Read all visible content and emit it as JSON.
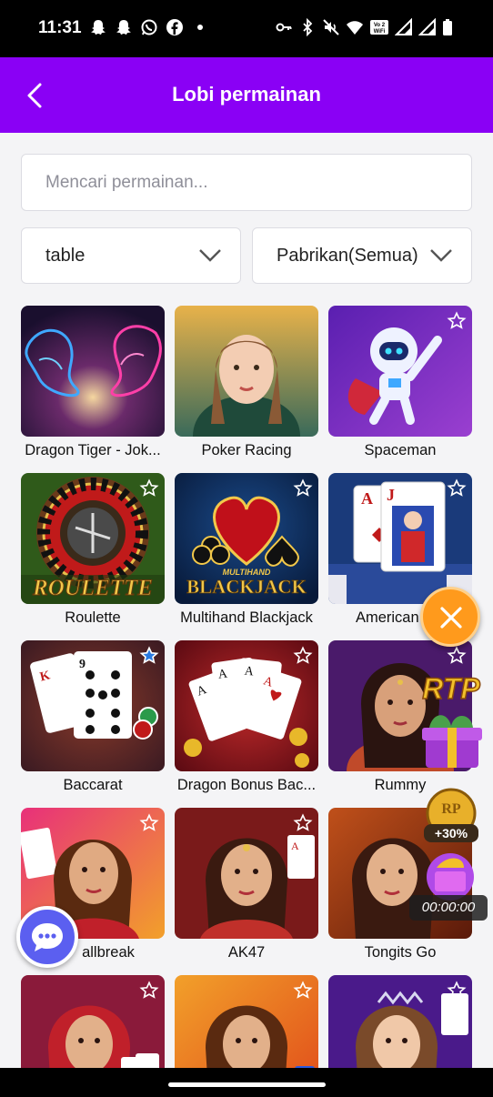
{
  "status_bar": {
    "time": "11:31",
    "left_icons": [
      "snapchat-icon",
      "snapchat-icon",
      "whatsapp-icon",
      "facebook-icon",
      "dot-icon"
    ],
    "right_icons": [
      "key-icon",
      "bluetooth-icon",
      "mute-icon",
      "wifi-icon",
      "vowifi-icon",
      "signal-icon",
      "signal-icon",
      "battery-icon"
    ],
    "vowifi_label": "Vo WiFi 2"
  },
  "header": {
    "title": "Lobi permainan",
    "background": "#8a00f5"
  },
  "search": {
    "placeholder": "Mencari permainan..."
  },
  "filters": {
    "category": "table",
    "manufacturer": "Pabrikan(Semua)"
  },
  "games": [
    {
      "name": "Dragon Tiger - Jok...",
      "favorite": false
    },
    {
      "name": "Poker Racing",
      "favorite": false
    },
    {
      "name": "Spaceman",
      "favorite": false
    },
    {
      "name": "Roulette",
      "favorite": false
    },
    {
      "name": "Multihand Blackjack",
      "favorite": false
    },
    {
      "name": "American Bla",
      "favorite": false
    },
    {
      "name": "Baccarat",
      "favorite": true
    },
    {
      "name": "Dragon Bonus Bac...",
      "favorite": false
    },
    {
      "name": "Rummy",
      "favorite": false
    },
    {
      "name": "allbreak",
      "favorite": false
    },
    {
      "name": "AK47",
      "favorite": false
    },
    {
      "name": "Tongits Go",
      "favorite": false
    },
    {
      "name": "",
      "favorite": false
    },
    {
      "name": "",
      "favorite": false
    },
    {
      "name": "",
      "favorite": false
    }
  ],
  "thumb_text": {
    "roulette": "ROULETTE",
    "blackjack_top": "MULTIHAND",
    "blackjack": "BLACKJACK",
    "rtp": "RTP"
  },
  "promo": {
    "coin_label": "+30%",
    "coin_letters": "RP",
    "timer": "00:00:00"
  },
  "colors": {
    "accent": "#8a00f5",
    "fab": "#ff9a1c",
    "chat": "#5b5ff0"
  }
}
